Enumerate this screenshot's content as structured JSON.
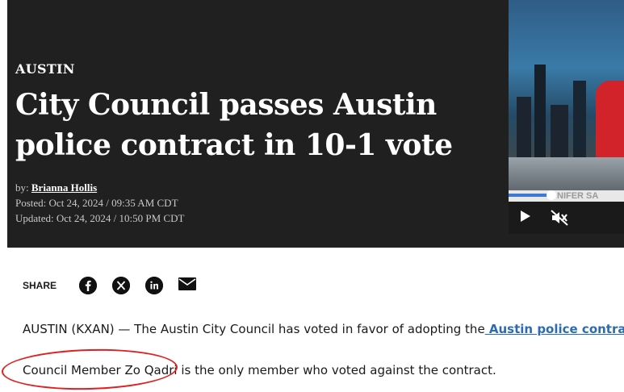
{
  "article": {
    "section": "AUSTIN",
    "headline_line1": "City Council passes Austin",
    "headline_line2": "police contract in 10-1 vote",
    "byline_prefix": "by:",
    "author": "Brianna Hollis",
    "posted": "Posted: Oct 24, 2024 / 09:35 AM CDT",
    "updated": "Updated: Oct 24, 2024 / 10:50 PM CDT"
  },
  "video": {
    "lower_third_text": "NIFER SA",
    "progress_fraction": 0.37
  },
  "share": {
    "label": "SHARE",
    "icons": [
      "facebook-icon",
      "x-icon",
      "linkedin-icon",
      "email-icon"
    ]
  },
  "body": {
    "p1_text": "AUSTIN (KXAN) — The Austin City Council has voted in favor of adopting the",
    "p1_link": " Austin police contract.",
    "p2_highlight": "Council Member Zo Qadri",
    "p2_rest": " is the only member who voted against the contract."
  },
  "colors": {
    "hero_bg": "#202020",
    "link": "#2b6cb0",
    "annotation": "#e02020",
    "progress": "#3d7ad6"
  }
}
